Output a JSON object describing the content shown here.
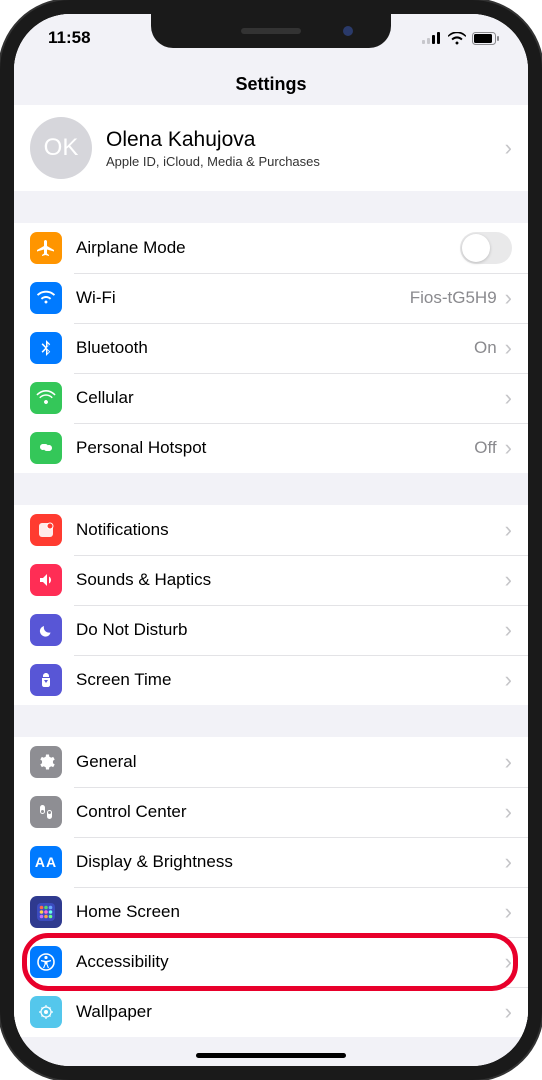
{
  "status": {
    "time": "11:58"
  },
  "header": {
    "title": "Settings"
  },
  "profile": {
    "initials": "OK",
    "name": "Olena Kahujova",
    "subtitle": "Apple ID, iCloud, Media & Purchases"
  },
  "group1": [
    {
      "key": "airplane",
      "label": "Airplane Mode",
      "value": "",
      "control": "switch",
      "color": "#ff9500"
    },
    {
      "key": "wifi",
      "label": "Wi-Fi",
      "value": "Fios-tG5H9",
      "control": "disclosure",
      "color": "#007aff"
    },
    {
      "key": "bluetooth",
      "label": "Bluetooth",
      "value": "On",
      "control": "disclosure",
      "color": "#007aff"
    },
    {
      "key": "cellular",
      "label": "Cellular",
      "value": "",
      "control": "disclosure",
      "color": "#34c759"
    },
    {
      "key": "hotspot",
      "label": "Personal Hotspot",
      "value": "Off",
      "control": "disclosure",
      "color": "#34c759"
    }
  ],
  "group2": [
    {
      "key": "notifications",
      "label": "Notifications",
      "color": "#ff3b30"
    },
    {
      "key": "sounds",
      "label": "Sounds & Haptics",
      "color": "#ff2d55"
    },
    {
      "key": "dnd",
      "label": "Do Not Disturb",
      "color": "#5856d6"
    },
    {
      "key": "screentime",
      "label": "Screen Time",
      "color": "#5856d6"
    }
  ],
  "group3": [
    {
      "key": "general",
      "label": "General",
      "color": "#8e8e93"
    },
    {
      "key": "controlcenter",
      "label": "Control Center",
      "color": "#8e8e93"
    },
    {
      "key": "display",
      "label": "Display & Brightness",
      "color": "#007aff"
    },
    {
      "key": "homescreen",
      "label": "Home Screen",
      "color": "#2f3a8f"
    },
    {
      "key": "accessibility",
      "label": "Accessibility",
      "color": "#007aff",
      "highlight": true
    },
    {
      "key": "wallpaper",
      "label": "Wallpaper",
      "color": "#54c7ec"
    }
  ]
}
